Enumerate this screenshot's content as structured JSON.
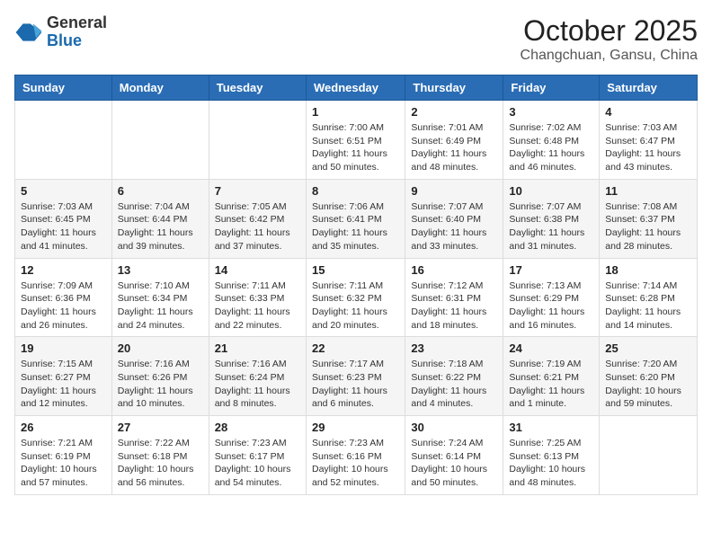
{
  "logo": {
    "general": "General",
    "blue": "Blue"
  },
  "header": {
    "month_year": "October 2025",
    "location": "Changchuan, Gansu, China"
  },
  "days_of_week": [
    "Sunday",
    "Monday",
    "Tuesday",
    "Wednesday",
    "Thursday",
    "Friday",
    "Saturday"
  ],
  "weeks": [
    [
      {
        "day": "",
        "info": ""
      },
      {
        "day": "",
        "info": ""
      },
      {
        "day": "",
        "info": ""
      },
      {
        "day": "1",
        "info": "Sunrise: 7:00 AM\nSunset: 6:51 PM\nDaylight: 11 hours\nand 50 minutes."
      },
      {
        "day": "2",
        "info": "Sunrise: 7:01 AM\nSunset: 6:49 PM\nDaylight: 11 hours\nand 48 minutes."
      },
      {
        "day": "3",
        "info": "Sunrise: 7:02 AM\nSunset: 6:48 PM\nDaylight: 11 hours\nand 46 minutes."
      },
      {
        "day": "4",
        "info": "Sunrise: 7:03 AM\nSunset: 6:47 PM\nDaylight: 11 hours\nand 43 minutes."
      }
    ],
    [
      {
        "day": "5",
        "info": "Sunrise: 7:03 AM\nSunset: 6:45 PM\nDaylight: 11 hours\nand 41 minutes."
      },
      {
        "day": "6",
        "info": "Sunrise: 7:04 AM\nSunset: 6:44 PM\nDaylight: 11 hours\nand 39 minutes."
      },
      {
        "day": "7",
        "info": "Sunrise: 7:05 AM\nSunset: 6:42 PM\nDaylight: 11 hours\nand 37 minutes."
      },
      {
        "day": "8",
        "info": "Sunrise: 7:06 AM\nSunset: 6:41 PM\nDaylight: 11 hours\nand 35 minutes."
      },
      {
        "day": "9",
        "info": "Sunrise: 7:07 AM\nSunset: 6:40 PM\nDaylight: 11 hours\nand 33 minutes."
      },
      {
        "day": "10",
        "info": "Sunrise: 7:07 AM\nSunset: 6:38 PM\nDaylight: 11 hours\nand 31 minutes."
      },
      {
        "day": "11",
        "info": "Sunrise: 7:08 AM\nSunset: 6:37 PM\nDaylight: 11 hours\nand 28 minutes."
      }
    ],
    [
      {
        "day": "12",
        "info": "Sunrise: 7:09 AM\nSunset: 6:36 PM\nDaylight: 11 hours\nand 26 minutes."
      },
      {
        "day": "13",
        "info": "Sunrise: 7:10 AM\nSunset: 6:34 PM\nDaylight: 11 hours\nand 24 minutes."
      },
      {
        "day": "14",
        "info": "Sunrise: 7:11 AM\nSunset: 6:33 PM\nDaylight: 11 hours\nand 22 minutes."
      },
      {
        "day": "15",
        "info": "Sunrise: 7:11 AM\nSunset: 6:32 PM\nDaylight: 11 hours\nand 20 minutes."
      },
      {
        "day": "16",
        "info": "Sunrise: 7:12 AM\nSunset: 6:31 PM\nDaylight: 11 hours\nand 18 minutes."
      },
      {
        "day": "17",
        "info": "Sunrise: 7:13 AM\nSunset: 6:29 PM\nDaylight: 11 hours\nand 16 minutes."
      },
      {
        "day": "18",
        "info": "Sunrise: 7:14 AM\nSunset: 6:28 PM\nDaylight: 11 hours\nand 14 minutes."
      }
    ],
    [
      {
        "day": "19",
        "info": "Sunrise: 7:15 AM\nSunset: 6:27 PM\nDaylight: 11 hours\nand 12 minutes."
      },
      {
        "day": "20",
        "info": "Sunrise: 7:16 AM\nSunset: 6:26 PM\nDaylight: 11 hours\nand 10 minutes."
      },
      {
        "day": "21",
        "info": "Sunrise: 7:16 AM\nSunset: 6:24 PM\nDaylight: 11 hours\nand 8 minutes."
      },
      {
        "day": "22",
        "info": "Sunrise: 7:17 AM\nSunset: 6:23 PM\nDaylight: 11 hours\nand 6 minutes."
      },
      {
        "day": "23",
        "info": "Sunrise: 7:18 AM\nSunset: 6:22 PM\nDaylight: 11 hours\nand 4 minutes."
      },
      {
        "day": "24",
        "info": "Sunrise: 7:19 AM\nSunset: 6:21 PM\nDaylight: 11 hours\nand 1 minute."
      },
      {
        "day": "25",
        "info": "Sunrise: 7:20 AM\nSunset: 6:20 PM\nDaylight: 10 hours\nand 59 minutes."
      }
    ],
    [
      {
        "day": "26",
        "info": "Sunrise: 7:21 AM\nSunset: 6:19 PM\nDaylight: 10 hours\nand 57 minutes."
      },
      {
        "day": "27",
        "info": "Sunrise: 7:22 AM\nSunset: 6:18 PM\nDaylight: 10 hours\nand 56 minutes."
      },
      {
        "day": "28",
        "info": "Sunrise: 7:23 AM\nSunset: 6:17 PM\nDaylight: 10 hours\nand 54 minutes."
      },
      {
        "day": "29",
        "info": "Sunrise: 7:23 AM\nSunset: 6:16 PM\nDaylight: 10 hours\nand 52 minutes."
      },
      {
        "day": "30",
        "info": "Sunrise: 7:24 AM\nSunset: 6:14 PM\nDaylight: 10 hours\nand 50 minutes."
      },
      {
        "day": "31",
        "info": "Sunrise: 7:25 AM\nSunset: 6:13 PM\nDaylight: 10 hours\nand 48 minutes."
      },
      {
        "day": "",
        "info": ""
      }
    ]
  ]
}
